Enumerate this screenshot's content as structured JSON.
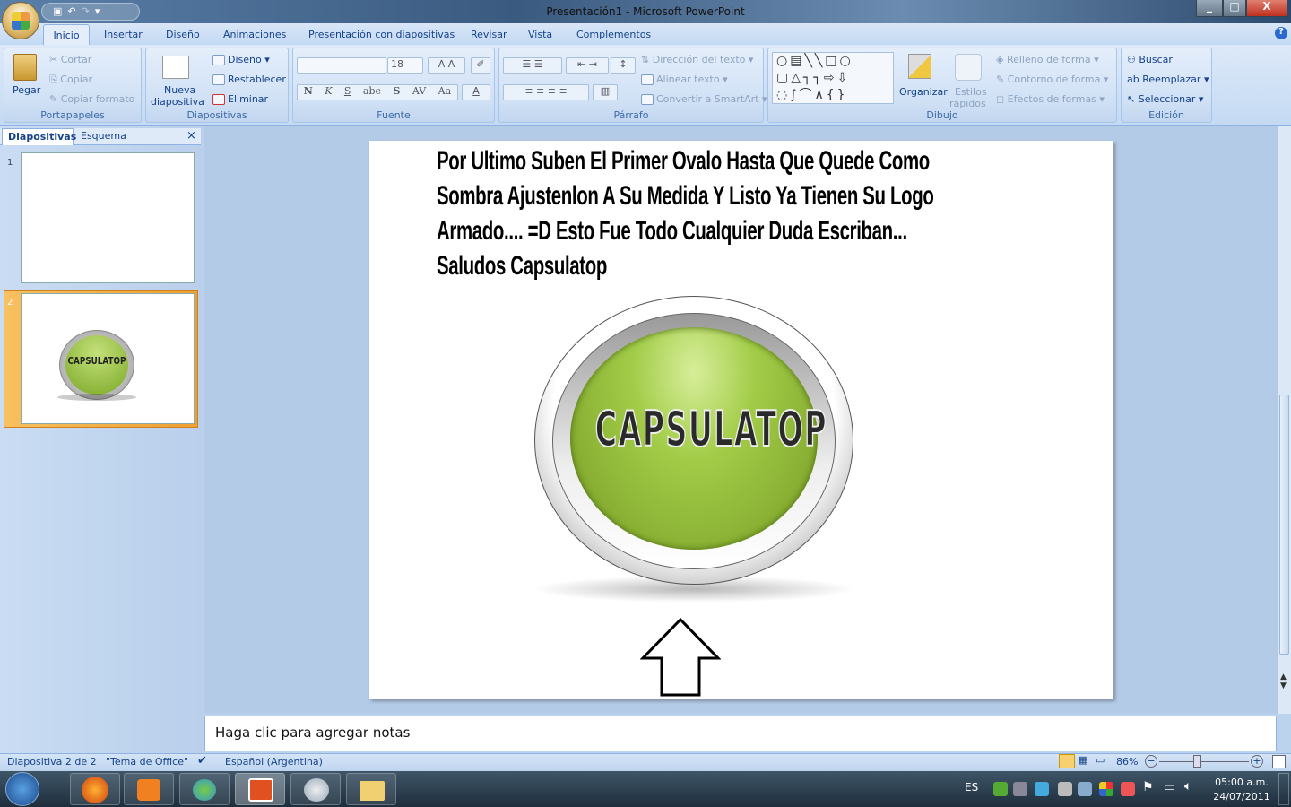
{
  "window": {
    "title": "Presentación1 - Microsoft PowerPoint",
    "minimize": "_",
    "maximize": "□",
    "close": "X"
  },
  "tabs": [
    "Inicio",
    "Insertar",
    "Diseño",
    "Animaciones",
    "Presentación con diapositivas",
    "Revisar",
    "Vista",
    "Complementos"
  ],
  "ribbon": {
    "portapapeles": {
      "label": "Portapapeles",
      "pegar": "Pegar",
      "cortar": "Cortar",
      "copiar": "Copiar",
      "copiar_formato": "Copiar formato"
    },
    "diapositivas": {
      "label": "Diapositivas",
      "nueva1": "Nueva",
      "nueva2": "diapositiva",
      "diseno": "Diseño",
      "restablecer": "Restablecer",
      "eliminar": "Eliminar"
    },
    "fuente": {
      "label": "Fuente",
      "font_size": "18",
      "bold": "N",
      "italic": "K",
      "underline": "S",
      "strike": "abe",
      "shadow": "S",
      "spacing": "AV",
      "case": "Aa",
      "color": "A"
    },
    "parrafo": {
      "label": "Párrafo",
      "direccion": "Dirección del texto",
      "alinear": "Alinear texto",
      "smartart": "Convertir a SmartArt"
    },
    "dibujo": {
      "label": "Dibujo",
      "organizar": "Organizar",
      "estilos1": "Estilos",
      "estilos2": "rápidos",
      "relleno": "Relleno de forma",
      "contorno": "Contorno de forma",
      "efectos": "Efectos de formas"
    },
    "edicion": {
      "label": "Edición",
      "buscar": "Buscar",
      "reemplazar": "Reemplazar",
      "seleccionar": "Seleccionar"
    }
  },
  "leftpane": {
    "tab_slides": "Diapositivas",
    "tab_outline": "Esquema",
    "close": "×",
    "slides": [
      {
        "num": "1"
      },
      {
        "num": "2",
        "logo": "CAPSULATOP"
      }
    ]
  },
  "slide": {
    "lines": [
      "Por Ultimo Suben El Primer Ovalo Hasta Que Quede Como",
      "Sombra Ajustenlon A Su Medida Y Listo Ya Tienen Su Logo",
      "Armado.... =D Esto Fue Todo Cualquier Duda Escriban...",
      "Saludos Capsulatop"
    ],
    "logo_text": "CAPSULATOP"
  },
  "notes": {
    "placeholder": "Haga clic para agregar notas"
  },
  "status": {
    "slide": "Diapositiva 2 de 2",
    "theme": "\"Tema de Office\"",
    "language": "Español (Argentina)",
    "zoom": "86%",
    "zoom_percent": 86
  },
  "taskbar": {
    "lang": "ES",
    "time": "05:00 a.m.",
    "date": "24/07/2011"
  }
}
